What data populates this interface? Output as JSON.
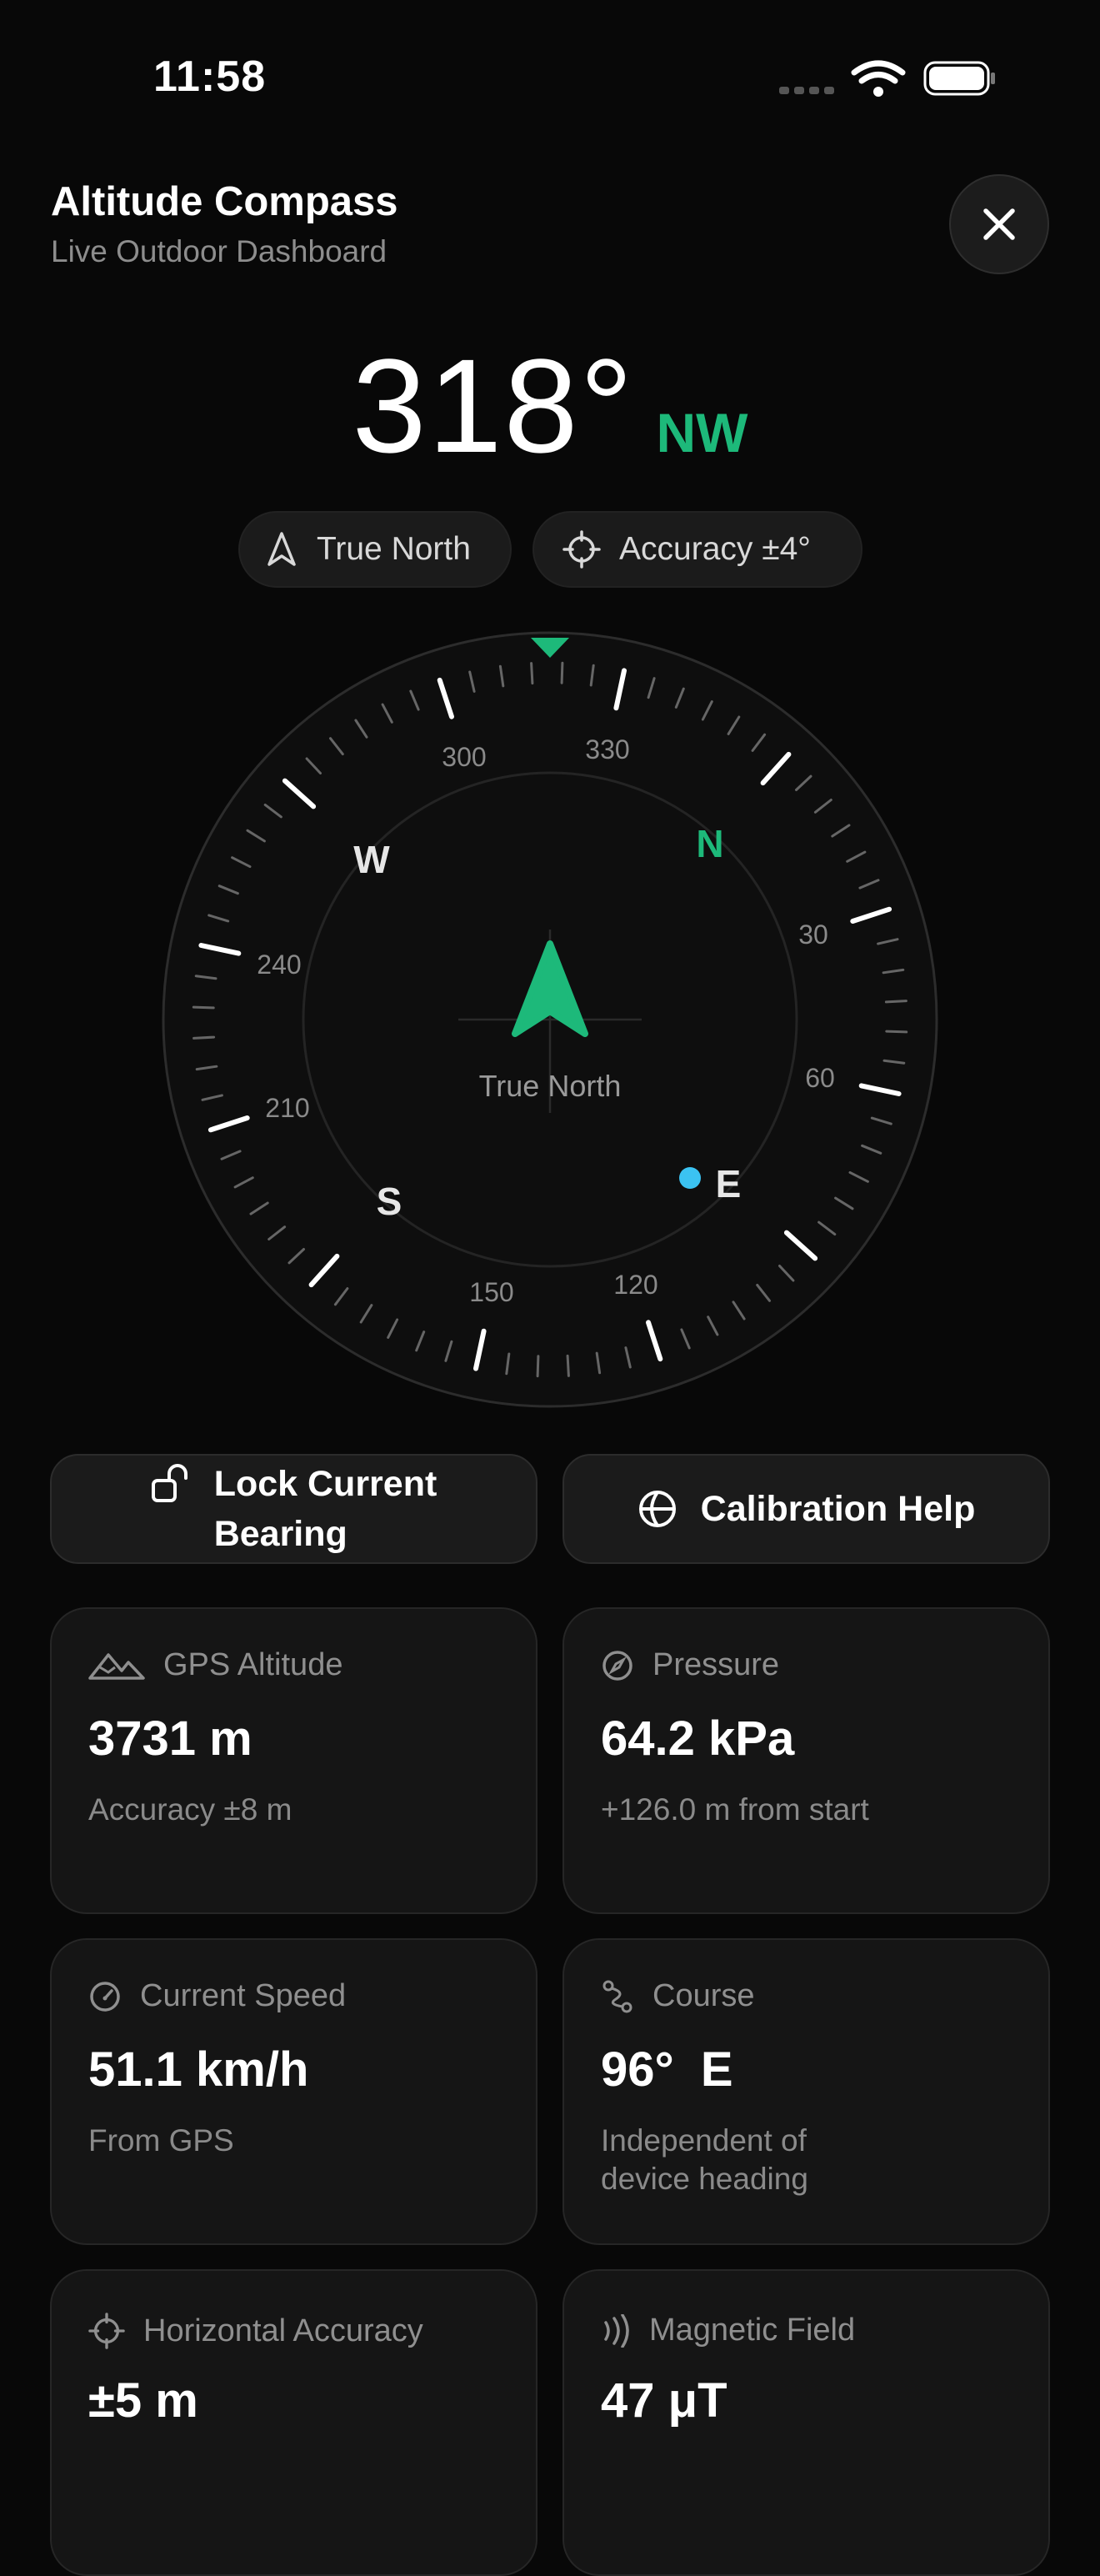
{
  "status": {
    "time": "11:58"
  },
  "header": {
    "title": "Altitude Compass",
    "subtitle": "Live Outdoor Dashboard"
  },
  "heading": {
    "degrees": "318°",
    "direction": "NW"
  },
  "pills": {
    "north_mode": "True North",
    "accuracy": "Accuracy ±4°"
  },
  "compass": {
    "center_label": "True North",
    "cardinals": {
      "n": "N",
      "e": "E",
      "s": "S",
      "w": "W"
    },
    "degree_labels": {
      "d30": "30",
      "d60": "60",
      "d120": "120",
      "d150": "150",
      "d210": "210",
      "d240": "240",
      "d300": "300",
      "d330": "330"
    },
    "heading_deg": 318,
    "accent_color": "#1db97a",
    "marker_color": "#3bc3f2"
  },
  "actions": {
    "lock_line1": "Lock Current",
    "lock_line2": "Bearing",
    "calibration": "Calibration Help"
  },
  "cards": {
    "altitude": {
      "label": "GPS Altitude",
      "value": "3731 m",
      "sub": "Accuracy ±8 m"
    },
    "pressure": {
      "label": "Pressure",
      "value": "64.2 kPa",
      "sub": "+126.0 m from start"
    },
    "speed": {
      "label": "Current Speed",
      "value": "51.1 km/h",
      "sub": "From GPS"
    },
    "course": {
      "label": "Course",
      "value": "96°  E",
      "sub": "Independent of device heading"
    },
    "h_accuracy": {
      "label": "Horizontal Accuracy",
      "value": "±5 m"
    },
    "magnetic": {
      "label": "Magnetic Field",
      "value": "47 μT"
    }
  }
}
